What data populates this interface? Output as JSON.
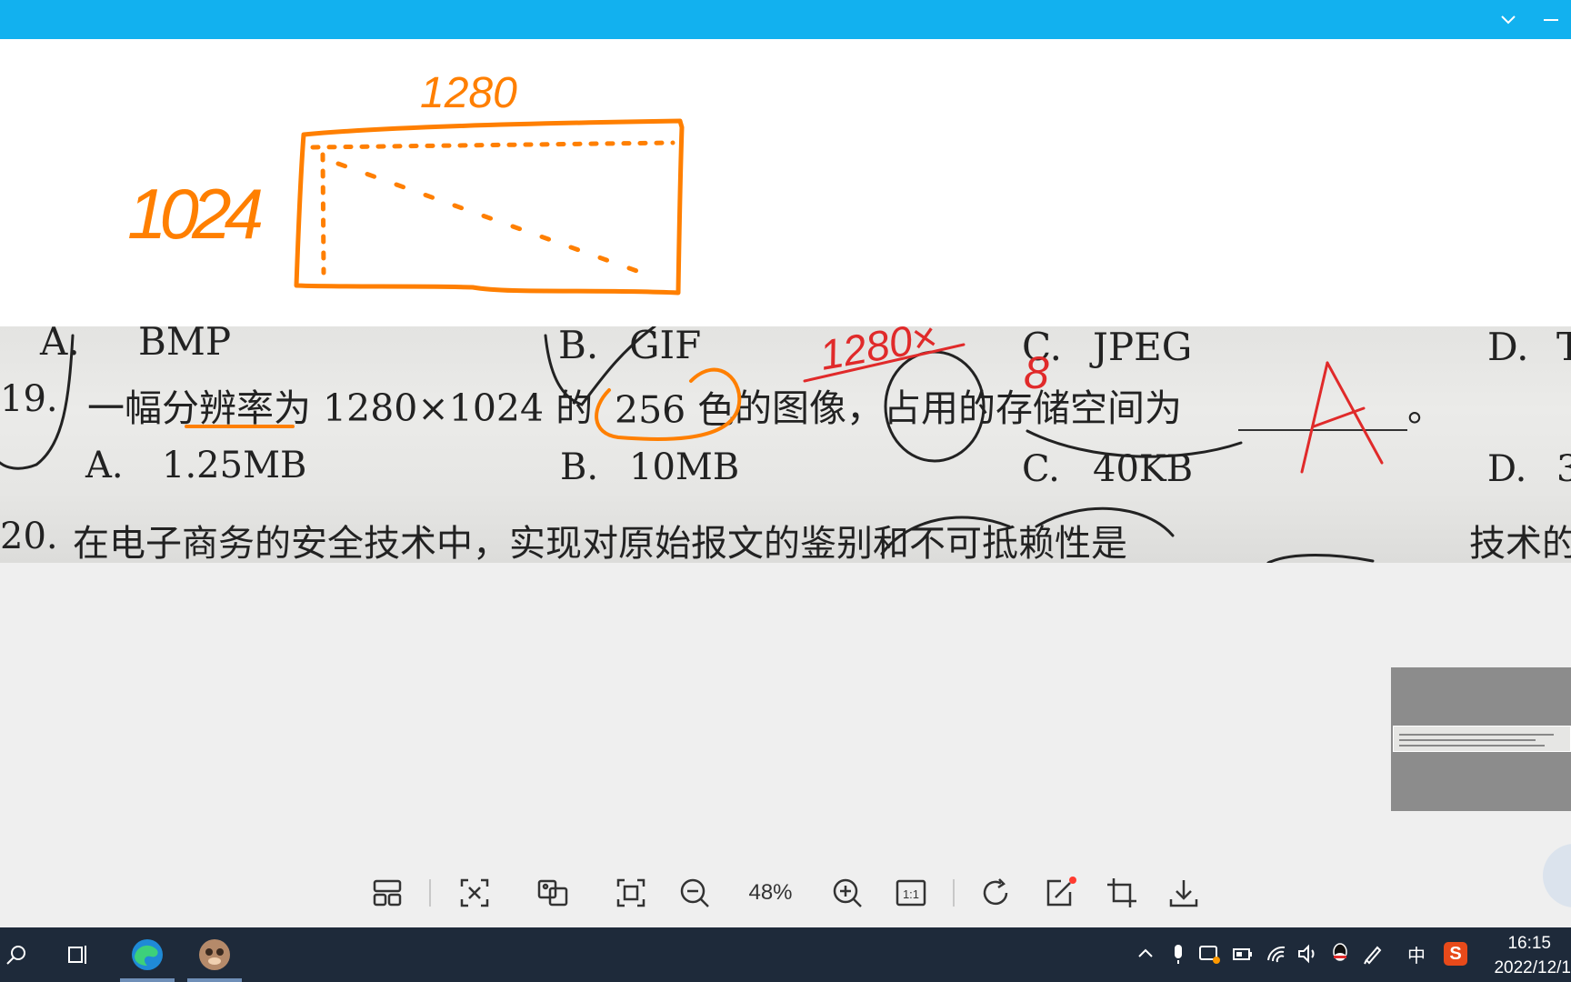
{
  "window": {
    "titlebar_color": "#12b1ef",
    "controls": [
      "chevron-down-icon",
      "minimize-icon"
    ]
  },
  "annotation": {
    "width_label": "1280",
    "height_label": "1024",
    "ink_color": "#ff7f00"
  },
  "photo": {
    "row_top": [
      "A.",
      "BMP",
      "B.",
      "GIF",
      "C.",
      "JPEG",
      "D.",
      "T"
    ],
    "q19": {
      "number": "19.",
      "text_before": "一幅分辨率为 1280×1024 的",
      "highlight": "256 色",
      "text_after": "的图像，占用的存储空间为",
      "blank_end": "。"
    },
    "q19_options": [
      {
        "letter": "A.",
        "value": "1.25MB"
      },
      {
        "letter": "B.",
        "value": "10MB"
      },
      {
        "letter": "C.",
        "value": "40KB"
      },
      {
        "letter": "D.",
        "value": "3"
      }
    ],
    "q20": {
      "number": "20.",
      "text": "在电子商务的安全技术中，实现对原始报文的鉴别和不可抵赖性是",
      "tail": "技术的"
    },
    "red_ink": {
      "answer": "A",
      "scribble": "1280×",
      "digit": "8",
      "color": "#e02a2a"
    }
  },
  "toolbar": {
    "zoom": "48%",
    "one_to_one": "1:1",
    "tools": [
      "layout-icon",
      "fit-screen-icon",
      "image-compare-icon",
      "fullscreen-icon",
      "zoom-out-icon",
      "zoom-in-icon",
      "actual-size-icon",
      "rotate-icon",
      "edit-icon",
      "crop-icon",
      "download-icon"
    ]
  },
  "taskbar": {
    "clock_time": "16:15",
    "clock_date": "2022/12/1",
    "ime_label": "中",
    "sogou_label": "S"
  }
}
